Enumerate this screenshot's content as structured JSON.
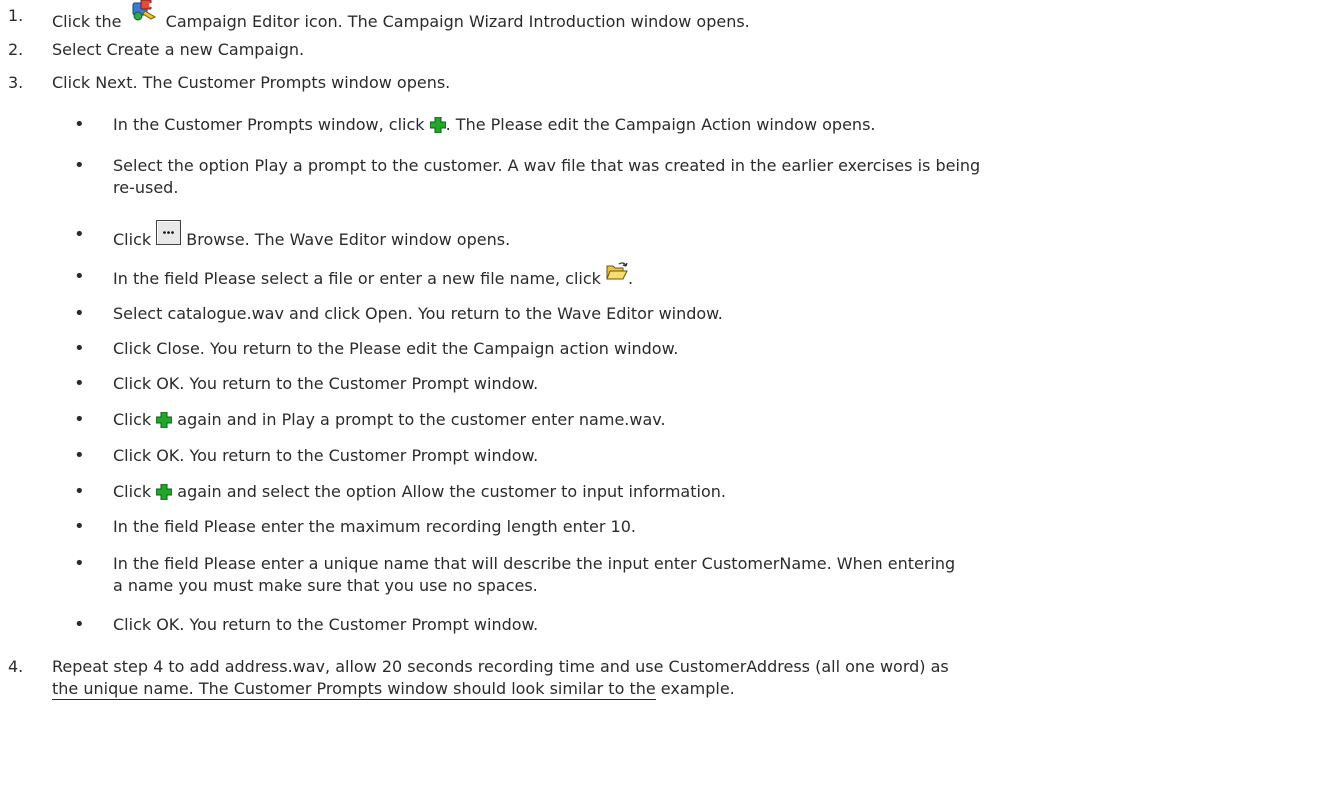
{
  "steps": [
    {
      "num": "1.",
      "pre": "Click the",
      "icon": "campaign-editor-icon",
      "post": "Campaign Editor icon. The Campaign Wizard Introduction window opens."
    },
    {
      "num": "2.",
      "text": "Select Create a new Campaign."
    },
    {
      "num": "3.",
      "text": "Click Next. The Customer Prompts window opens."
    },
    {
      "num": "4.",
      "line1": "Repeat step 4 to add address.wav, allow 20 seconds recording time and use CustomerAddress (all one word) as",
      "line2_link": "the unique name. The Customer Prompts window should look similar to the",
      "line2_rest": " example."
    }
  ],
  "bullets": [
    {
      "pre": "In the Customer Prompts window, click ",
      "icon": "green-plus-icon",
      "post": ". The Please edit the Campaign Action window opens."
    },
    {
      "line1": "Select the option Play a prompt to the customer. A wav file that was created in the earlier exercises is being",
      "line2": "re-used."
    },
    {
      "pre": "Click ",
      "icon": "browse-button-icon",
      "post": " Browse. The Wave Editor window opens."
    },
    {
      "pre": "In the field Please select a file or enter a new file name, click ",
      "icon": "open-folder-icon",
      "post": "."
    },
    {
      "text": "Select catalogue.wav and click Open. You return to the Wave Editor window."
    },
    {
      "text": "Click Close. You return to the Please edit the Campaign action window."
    },
    {
      "text": "Click OK. You return to the Customer Prompt window."
    },
    {
      "pre": "Click ",
      "icon": "green-plus-icon",
      "post": " again and in Play a prompt to the customer enter name.wav."
    },
    {
      "text": "Click OK. You return to the Customer Prompt window."
    },
    {
      "pre": "Click ",
      "icon": "green-plus-icon",
      "post": " again and select the option Allow the customer to input information."
    },
    {
      "text": "In the field Please enter the maximum recording length enter 10."
    },
    {
      "line1": "In the field Please enter a unique name that will describe the input enter CustomerName. When entering",
      "line2": "a name you must make sure that you use no spaces."
    },
    {
      "text": "Click OK. You return to the Customer Prompt window."
    }
  ],
  "bullet_char": "•",
  "colors": {
    "text": "#2b2b2b",
    "plus_green": "#1fa82a"
  }
}
